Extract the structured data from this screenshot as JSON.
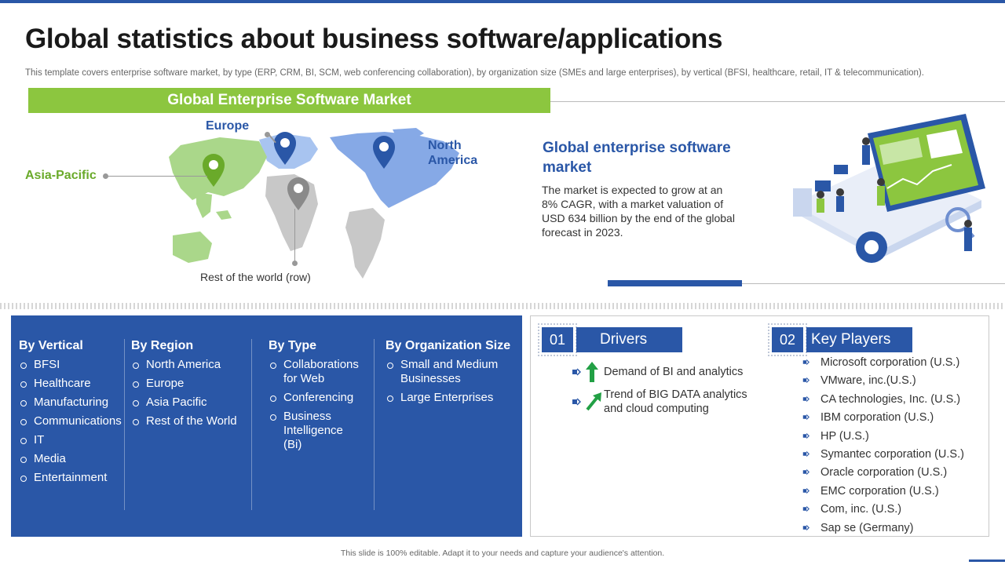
{
  "title": "Global statistics about business software/applications",
  "subtitle": "This template covers enterprise software market, by type (ERP, CRM, BI, SCM, web conferencing collaboration), by organization size (SMEs and large enterprises), by vertical (BFSI, healthcare, retail, IT & telecommunication).",
  "market_section": {
    "bar_title": "Global Enterprise Software Market",
    "regions": {
      "europe": "Europe",
      "north_america": "North America",
      "asia_pacific": "Asia-Pacific",
      "rest_of_world": "Rest of the world (row)"
    },
    "heading": "Global enterprise software market",
    "text": "The market is expected to grow at an 8% CAGR, with a market valuation of USD 634 billion by the end of the global forecast in 2023."
  },
  "segments": [
    {
      "title": "By Vertical",
      "items": [
        "BFSI",
        "Healthcare",
        "Manufacturing",
        "Communications",
        "IT",
        "Media",
        "Entertainment"
      ]
    },
    {
      "title": "By Region",
      "items": [
        "North America",
        "Europe",
        "Asia Pacific",
        "Rest of the World"
      ]
    },
    {
      "title": "By Type",
      "items": [
        "Collaborations for Web",
        "Conferencing",
        "Business Intelligence (Bi)"
      ]
    },
    {
      "title": "By Organization Size",
      "items": [
        "Small and Medium Businesses",
        "Large Enterprises"
      ]
    }
  ],
  "drivers": {
    "number": "01",
    "title": "Drivers",
    "items": [
      "Demand of BI and analytics",
      "Trend of BIG DATA analytics and cloud computing"
    ],
    "icons": [
      "arrow-up-icon",
      "arrow-up-right-icon"
    ]
  },
  "key_players": {
    "number": "02",
    "title": "Key Players",
    "items": [
      "Microsoft corporation (U.S.)",
      "VMware, inc.(U.S.)",
      "CA technologies, Inc. (U.S.)",
      "IBM corporation (U.S.)",
      "HP (U.S.)",
      "Symantec corporation (U.S.)",
      "Oracle corporation (U.S.)",
      "EMC corporation (U.S.)",
      "Com, inc. (U.S.)",
      "Sap se (Germany)"
    ]
  },
  "footer": "This slide is 100% editable. Adapt it to your needs and capture your audience's attention.",
  "colors": {
    "primary": "#2a57a7",
    "accent": "#8cc63f"
  }
}
